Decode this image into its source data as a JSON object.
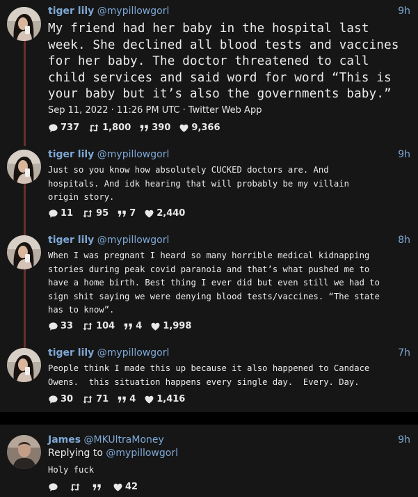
{
  "tweets": [
    {
      "name": "tiger lily",
      "handle": "@mypillowgorl",
      "time": "9h",
      "text": "My friend had her baby in the hospital last\nweek. She declined all blood tests and vaccines\nfor her baby. The doctor threatened to call\nchild services and said word for word “This is\nyour baby but it’s also the governments baby.”",
      "meta": "Sep 11, 2022 · 11:26 PM UTC · Twitter Web App",
      "replies": "737",
      "retweets": "1,800",
      "quotes": "390",
      "likes": "9,366"
    },
    {
      "name": "tiger lily",
      "handle": "@mypillowgorl",
      "time": "9h",
      "text": "Just so you know how absolutely CUCKED doctors are. And\nhospitals. And idk hearing that will probably be my villain\norigin story.",
      "replies": "11",
      "retweets": "95",
      "quotes": "7",
      "likes": "2,440"
    },
    {
      "name": "tiger lily",
      "handle": "@mypillowgorl",
      "time": "8h",
      "text": "When I was pregnant I heard so many horrible medical kidnapping\nstories during peak covid paranoia and that’s what pushed me to\nhave a home birth. Best thing I ever did but even still we had to\nsign shit saying we were denying blood tests/vaccines. “The state\nhas to know”.",
      "replies": "33",
      "retweets": "104",
      "quotes": "4",
      "likes": "1,998"
    },
    {
      "name": "tiger lily",
      "handle": "@mypillowgorl",
      "time": "7h",
      "text": "People think I made this up because it also happened to Candace\nOwens.  this situation happens every single day.  Every. Day.",
      "replies": "30",
      "retweets": "71",
      "quotes": "4",
      "likes": "1,416"
    }
  ],
  "reply": {
    "name": "James",
    "handle": "@MKUltraMoney",
    "time": "9h",
    "replying_prefix": "Replying to",
    "replying_to": "@mypillowgorl",
    "text": "Holy fuck",
    "likes": "42"
  },
  "icons": {
    "reply": "comment-bubble-icon",
    "retweet": "retweet-icon",
    "quote": "quote-icon",
    "like": "heart-icon"
  },
  "colors": {
    "background": "#161616",
    "link": "#7ea8d6",
    "thread_line": "#6a2f28"
  }
}
